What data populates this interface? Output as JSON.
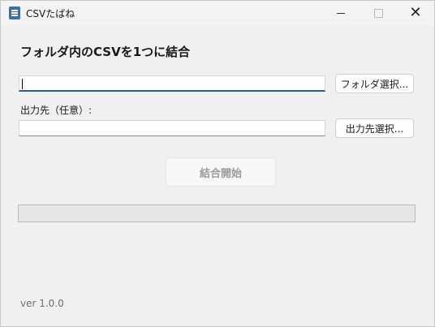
{
  "window": {
    "title": "CSVたばね",
    "app_icon": "app-document-icon",
    "controls": [
      "minimize-icon",
      "maximize-icon",
      "close-icon"
    ]
  },
  "heading": "フォルダ内のCSVを1つに結合",
  "folder": {
    "value": "",
    "button_label": "フォルダ選択..."
  },
  "output": {
    "label": "出力先（任意）:",
    "value": "",
    "button_label": "出力先選択..."
  },
  "start_button": {
    "label": "結合開始",
    "enabled": false
  },
  "progress": {
    "fraction": 0
  },
  "version": "ver 1.0.0"
}
